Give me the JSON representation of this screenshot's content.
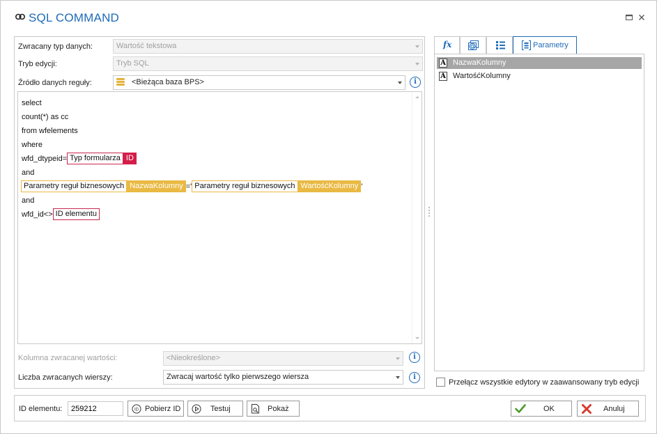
{
  "window": {
    "title": "SQL COMMAND"
  },
  "form": {
    "return_type_label": "Zwracany typ danych:",
    "return_type_value": "Wartość tekstowa",
    "edit_mode_label": "Tryb edycji:",
    "edit_mode_value": "Tryb SQL",
    "source_label": "Źródło danych reguły:",
    "source_value": "<Bieżąca baza BPS>",
    "return_column_label": "Kolumna zwracanej wartości:",
    "return_column_value": "<Nieokreślone>",
    "row_count_label": "Liczba zwracanych wierszy:",
    "row_count_value": "Zwracaj wartość tylko pierwszego wiersza",
    "info_glyph": "i"
  },
  "editor": {
    "line1": "select",
    "line2": "count(*) as cc",
    "line3": "from wfelements",
    "line4": "where",
    "line5_prefix": "wfd_dtypeid=",
    "line5_token": "Typ formularza",
    "line5_badge": "ID",
    "line6": "and",
    "line7_token1": "Parametry reguł biznesowych",
    "line7_badge1": "NazwaKolumny",
    "line7_mid": "='",
    "line7_token2": "Parametry reguł biznesowych",
    "line7_badge2": "WartośćKolumny",
    "line7_suffix": "'",
    "line8": "and",
    "line9_prefix": "wfd_id<>",
    "line9_token": "ID elementu"
  },
  "tabs": {
    "tab1_icon": "fx",
    "tab4_label": "Parametry"
  },
  "parameters": [
    {
      "type": "A",
      "name": "NazwaKolumny",
      "selected": true
    },
    {
      "type": "A",
      "name": "WartośćKolumny",
      "selected": false
    }
  ],
  "advanced_toggle": {
    "label": "Przełącz wszystkie edytory w zaawansowany tryb edycji",
    "checked": false
  },
  "bottom": {
    "element_id_label": "ID elementu:",
    "element_id_value": "259212",
    "fetch_id_label": "Pobierz ID",
    "test_label": "Testuj",
    "show_label": "Pokaż",
    "ok_label": "OK",
    "cancel_label": "Anuluj"
  },
  "colors": {
    "accent": "#1e6bb8",
    "form_token": "#d41d4a",
    "param_token": "#e9b942",
    "ok_green": "#4a9a2c",
    "cancel_red": "#d63a2f"
  }
}
